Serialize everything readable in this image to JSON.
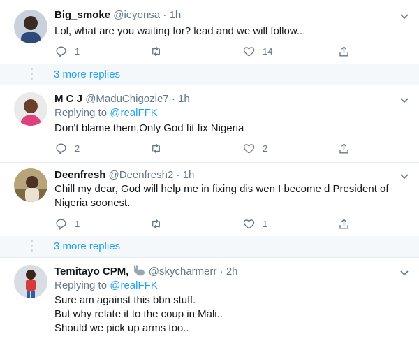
{
  "colors": {
    "accent": "#1da1f2",
    "secondary_text": "#657786",
    "divider": "#e6ecf0"
  },
  "tweets": [
    {
      "name": "Big_smoke",
      "handle": "@ieyonsa",
      "sep": "·",
      "time": "1h",
      "reply_to_label": "",
      "mention": "",
      "text": "Lol, what are you waiting for? lead and we will follow...",
      "replies": "1",
      "retweets": "",
      "likes": "14"
    },
    {
      "name": "M C J",
      "handle": "@MaduChigozie7",
      "sep": "·",
      "time": "1h",
      "reply_to_label": "Replying to",
      "mention": "@realFFK",
      "text": "Don't blame them,Only God fit fix Nigeria",
      "replies": "2",
      "retweets": "",
      "likes": "2"
    },
    {
      "name": "Deenfresh",
      "handle": "@Deenfresh2",
      "sep": "·",
      "time": "1h",
      "reply_to_label": "",
      "mention": "",
      "text": "Chill my dear, God will help me in fixing dis wen I become d President of\nNigeria  soonest.",
      "replies": "1",
      "retweets": "",
      "likes": "1"
    },
    {
      "name": "Temitayo CPM,",
      "handle": "@skycharmerr",
      "sep": "·",
      "time": "2h",
      "reply_to_label": "Replying to",
      "mention": "@realFFK",
      "text": "Sure am against this bbn stuff.\nBut why relate it to the coup in Mali..\nShould we pick up arms too..",
      "replies": "",
      "retweets": "",
      "likes": ""
    }
  ],
  "more_replies": [
    "3 more replies",
    "3 more replies"
  ],
  "icons": [
    "reply-icon",
    "retweet-icon",
    "like-icon",
    "share-icon",
    "chevron-down-icon",
    "rabbit-emoji-icon"
  ]
}
